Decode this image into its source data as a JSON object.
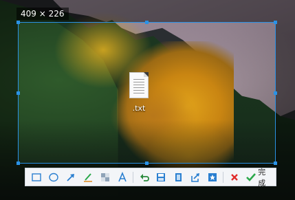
{
  "selection": {
    "size_text": "409 × 226"
  },
  "desktop_file": {
    "name": ".txt",
    "icon": "text-document-icon"
  },
  "toolbar": {
    "tools": [
      {
        "name": "rectangle-tool",
        "icon": "rectangle-icon"
      },
      {
        "name": "ellipse-tool",
        "icon": "ellipse-icon"
      },
      {
        "name": "arrow-tool",
        "icon": "arrow-icon"
      },
      {
        "name": "pen-tool",
        "icon": "pen-icon"
      },
      {
        "name": "mosaic-tool",
        "icon": "mosaic-icon"
      },
      {
        "name": "text-tool",
        "icon": "text-icon"
      },
      {
        "name": "undo",
        "icon": "undo-icon"
      },
      {
        "name": "save",
        "icon": "save-icon"
      },
      {
        "name": "copy",
        "icon": "copy-icon"
      },
      {
        "name": "share",
        "icon": "share-icon"
      },
      {
        "name": "pin",
        "icon": "pin-icon"
      },
      {
        "name": "cancel",
        "icon": "close-icon"
      }
    ],
    "done_label": "完成",
    "colors": {
      "accent": "#2a92e6",
      "cancel": "#e02b2b",
      "done": "#2aa84a"
    }
  }
}
